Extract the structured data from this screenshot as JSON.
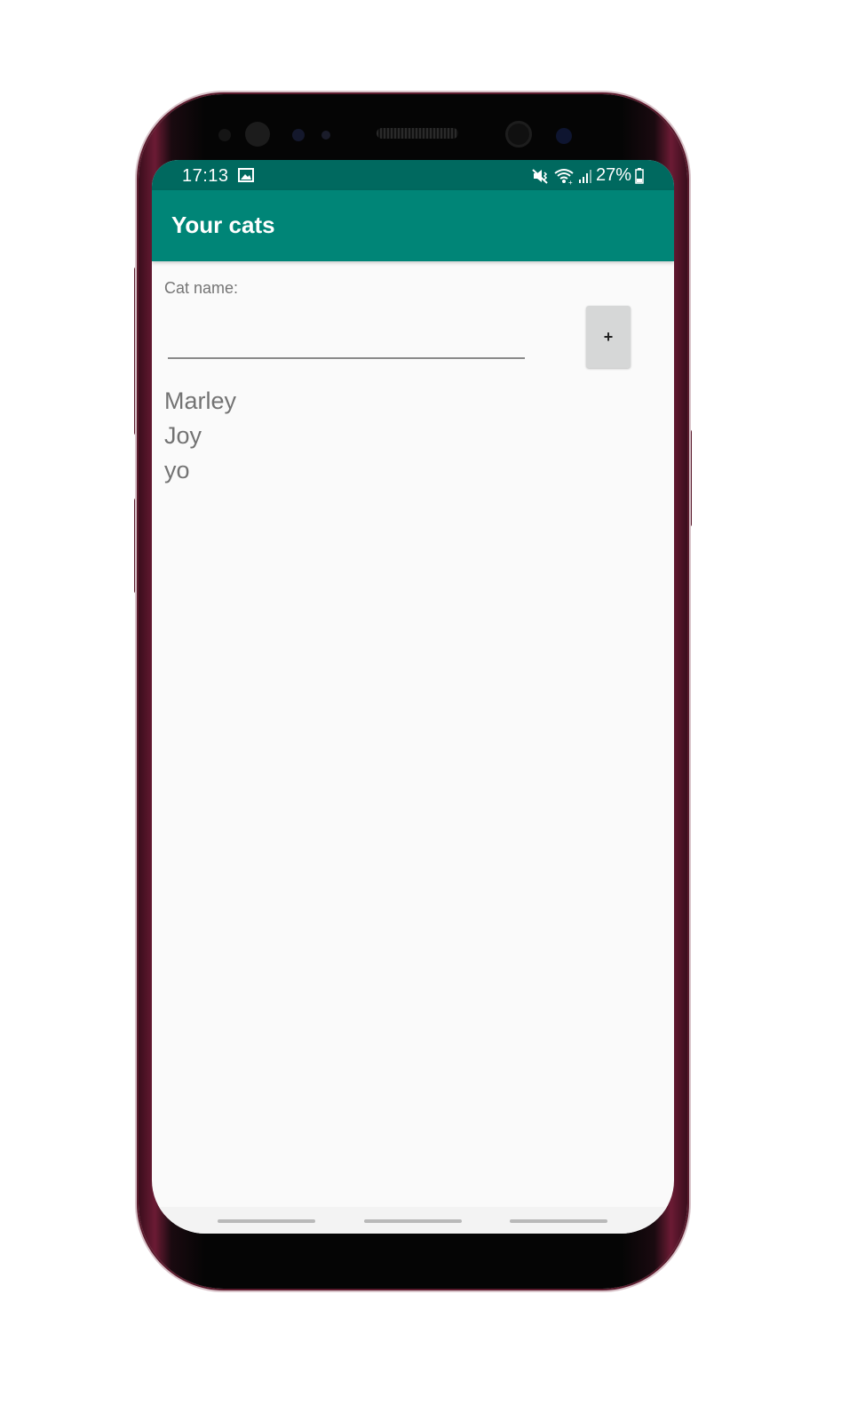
{
  "status_bar": {
    "time": "17:13",
    "battery": "27%",
    "icons": [
      "gallery-icon",
      "mute-vibrate-icon",
      "wifi-icon",
      "signal-icon",
      "battery-icon"
    ]
  },
  "app_bar": {
    "title": "Your cats",
    "color": "#008577",
    "status_color": "#00695f"
  },
  "form": {
    "label": "Cat name:",
    "input_value": "",
    "add_button_label": "+"
  },
  "cats": [
    "Marley",
    "Joy",
    "yo"
  ]
}
